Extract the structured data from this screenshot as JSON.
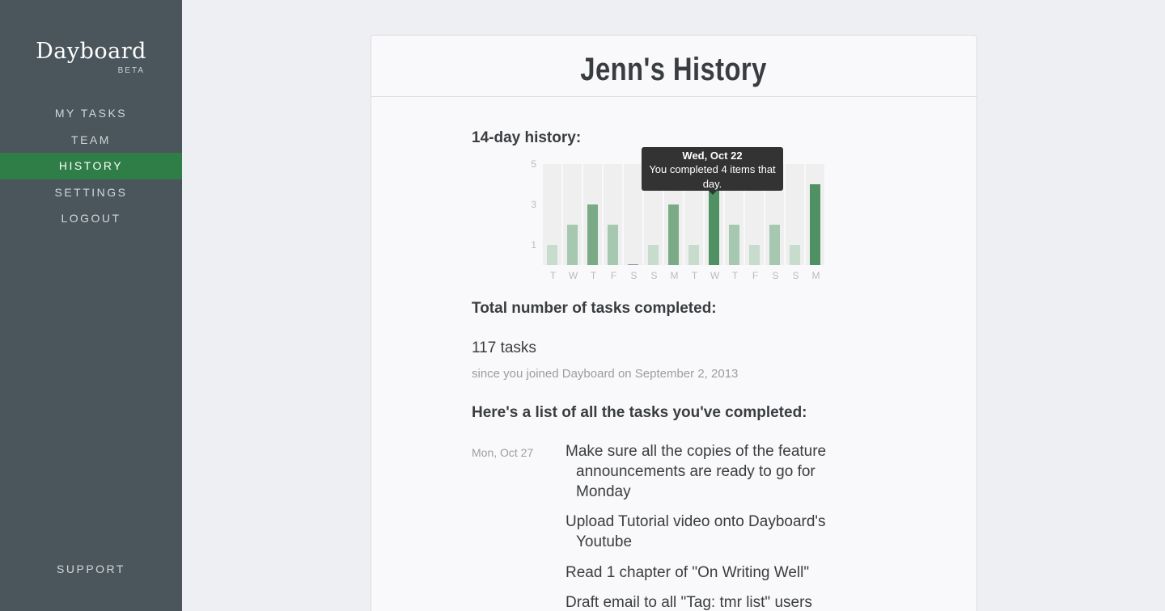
{
  "app": {
    "logo": "Dayboard",
    "beta": "BETA"
  },
  "nav": {
    "items": [
      {
        "label": "MY TASKS"
      },
      {
        "label": "TEAM"
      },
      {
        "label": "HISTORY",
        "active": true
      },
      {
        "label": "SETTINGS"
      },
      {
        "label": "LOGOUT"
      }
    ],
    "support": "SUPPORT"
  },
  "page": {
    "title": "Jenn's History"
  },
  "history": {
    "label": "14-day history:",
    "tooltip": {
      "date": "Wed, Oct 22",
      "text": "You completed 4 items that day."
    }
  },
  "chart_data": {
    "type": "bar",
    "categories": [
      "T",
      "W",
      "T",
      "F",
      "S",
      "S",
      "M",
      "T",
      "W",
      "T",
      "F",
      "S",
      "S",
      "M"
    ],
    "values": [
      1,
      2,
      3,
      2,
      0,
      1,
      3,
      1,
      4,
      2,
      1,
      2,
      1,
      4
    ],
    "yticks": [
      5,
      3,
      1
    ],
    "ylim": [
      0,
      5
    ],
    "highlighted_index": 8,
    "colors": {
      "low": "#c7dccd",
      "mid": "#a6c8b0",
      "high": "#7aab86",
      "top": "#4f9163",
      "slot": "#efefef"
    }
  },
  "total": {
    "label": "Total number of tasks completed:",
    "count": "117 tasks",
    "since": "since you joined Dayboard on September 2, 2013"
  },
  "tasks": {
    "label": "Here's a list of all the tasks you've completed:",
    "groups": [
      {
        "date": "Mon, Oct 27",
        "items": [
          "Make sure all the copies of the feature announcements are ready to go for Monday",
          "Upload Tutorial video onto Dayboard's Youtube",
          "Read 1 chapter of \"On Writing Well\"",
          "Draft email to all \"Tag: tmr list\" users"
        ]
      }
    ]
  }
}
